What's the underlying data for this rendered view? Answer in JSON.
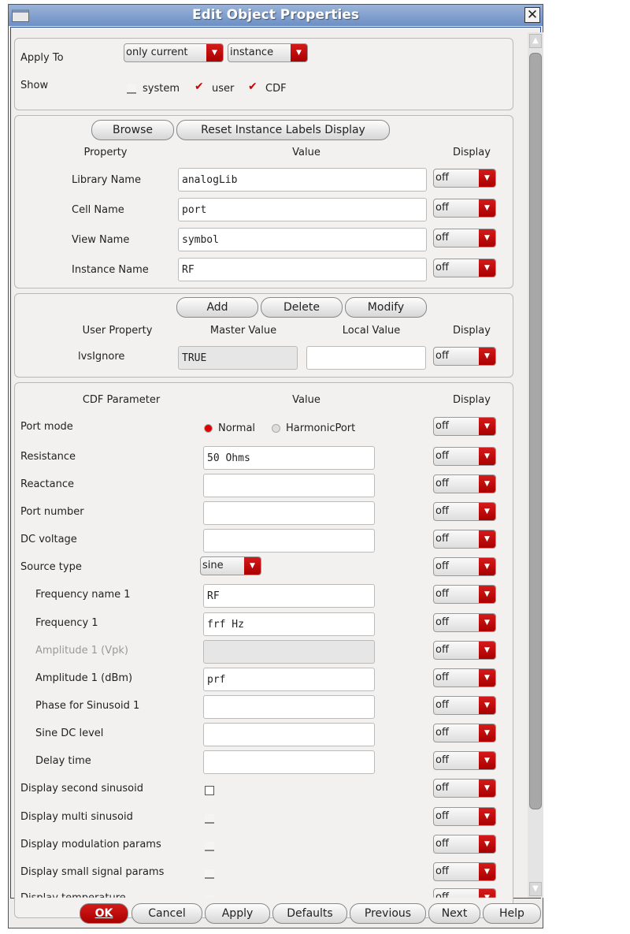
{
  "window": {
    "title": "Edit Object Properties"
  },
  "apply_to": {
    "label": "Apply To",
    "scope": "only current",
    "type": "instance"
  },
  "show": {
    "label": "Show",
    "options": [
      {
        "label": "system",
        "checked": false
      },
      {
        "label": "user",
        "checked": true
      },
      {
        "label": "CDF",
        "checked": true
      }
    ]
  },
  "properties": {
    "browse": "Browse",
    "reset": "Reset Instance Labels Display",
    "headers": [
      "Property",
      "Value",
      "Display"
    ],
    "rows": [
      {
        "label": "Library Name",
        "value": "analogLib",
        "display": "off"
      },
      {
        "label": "Cell Name",
        "value": "port",
        "display": "off"
      },
      {
        "label": "View Name",
        "value": "symbol",
        "display": "off"
      },
      {
        "label": "Instance Name",
        "value": "RF",
        "display": "off"
      }
    ]
  },
  "user_props": {
    "add": "Add",
    "delete": "Delete",
    "modify": "Modify",
    "headers": [
      "User Property",
      "Master Value",
      "Local Value",
      "Display"
    ],
    "rows": [
      {
        "label": "lvsIgnore",
        "master": "TRUE",
        "local": "",
        "display": "off"
      }
    ]
  },
  "cdf": {
    "headers": [
      "CDF Parameter",
      "Value",
      "Display"
    ],
    "rows": [
      {
        "label": "Port mode",
        "kind": "radio",
        "options": [
          "Normal",
          "HarmonicPort"
        ],
        "selected": "Normal",
        "display": "off"
      },
      {
        "label": "Resistance",
        "kind": "text",
        "value": "50 Ohms",
        "display": "off"
      },
      {
        "label": "Reactance",
        "kind": "text",
        "value": "",
        "display": "off"
      },
      {
        "label": "Port number",
        "kind": "text",
        "value": "",
        "display": "off"
      },
      {
        "label": "DC voltage",
        "kind": "text",
        "value": "",
        "display": "off"
      },
      {
        "label": "Source type",
        "kind": "select",
        "value": "sine",
        "display": "off"
      },
      {
        "label": "Frequency name 1",
        "kind": "text",
        "value": "RF",
        "indent": true,
        "display": "off"
      },
      {
        "label": "Frequency 1",
        "kind": "text",
        "value": "frf Hz",
        "indent": true,
        "display": "off"
      },
      {
        "label": "Amplitude 1 (Vpk)",
        "kind": "text",
        "value": "",
        "indent": true,
        "disabled": true,
        "display": "off"
      },
      {
        "label": "Amplitude 1 (dBm)",
        "kind": "text",
        "value": "prf",
        "indent": true,
        "display": "off"
      },
      {
        "label": "Phase for Sinusoid 1",
        "kind": "text",
        "value": "",
        "indent": true,
        "display": "off"
      },
      {
        "label": "Sine DC level",
        "kind": "text",
        "value": "",
        "indent": true,
        "display": "off"
      },
      {
        "label": "Delay time",
        "kind": "text",
        "value": "",
        "indent": true,
        "display": "off"
      },
      {
        "label": "Display second sinusoid",
        "kind": "checkbox",
        "checked": false,
        "display": "off"
      },
      {
        "label": "Display multi sinusoid",
        "kind": "checkbox",
        "checked": false,
        "display": "off"
      },
      {
        "label": "Display modulation params",
        "kind": "checkbox",
        "checked": false,
        "display": "off"
      },
      {
        "label": "Display small signal params",
        "kind": "checkbox",
        "checked": false,
        "display": "off"
      },
      {
        "label": "Display temperature",
        "kind": "checkbox",
        "checked": false,
        "display": "off"
      }
    ]
  },
  "buttons": {
    "ok": "OK",
    "cancel": "Cancel",
    "apply": "Apply",
    "defaults": "Defaults",
    "previous": "Previous",
    "next": "Next",
    "help": "Help"
  }
}
